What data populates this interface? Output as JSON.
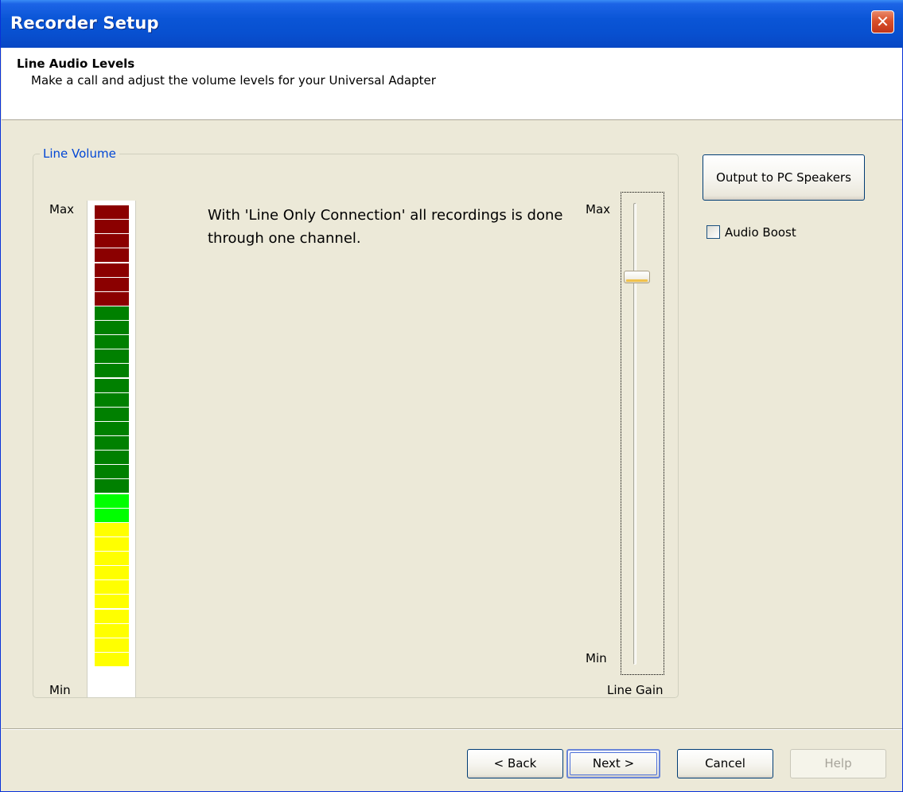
{
  "window": {
    "title": "Recorder Setup",
    "close_glyph": "✕"
  },
  "header": {
    "title": "Line Audio Levels",
    "subtitle": "Make a call and adjust the volume levels for your Universal Adapter"
  },
  "line_volume": {
    "group_label": "Line Volume",
    "meter": {
      "max_label": "Max",
      "min_label": "Min",
      "segments": 32,
      "segment_colors": {
        "red": "#8b0000",
        "dark_green": "#008000",
        "bright_green": "#00ff00",
        "yellow": "#ffff00"
      },
      "segment_bands": [
        {
          "color": "red",
          "count": 7
        },
        {
          "color": "dark_green",
          "count": 13
        },
        {
          "color": "bright_green",
          "count": 2
        },
        {
          "color": "yellow",
          "count": 10
        }
      ]
    },
    "description": "With 'Line Only Connection' all recordings is done through one channel.",
    "gain_slider": {
      "max_label": "Max",
      "min_label": "Min",
      "name": "Line Gain",
      "level": 0.86
    }
  },
  "side": {
    "output_button": "Output to PC Speakers",
    "audio_boost_label": "Audio Boost",
    "audio_boost_checked": false
  },
  "footer": {
    "back_label": "< Back",
    "next_label": "Next >",
    "cancel_label": "Cancel",
    "help_label": "Help"
  }
}
